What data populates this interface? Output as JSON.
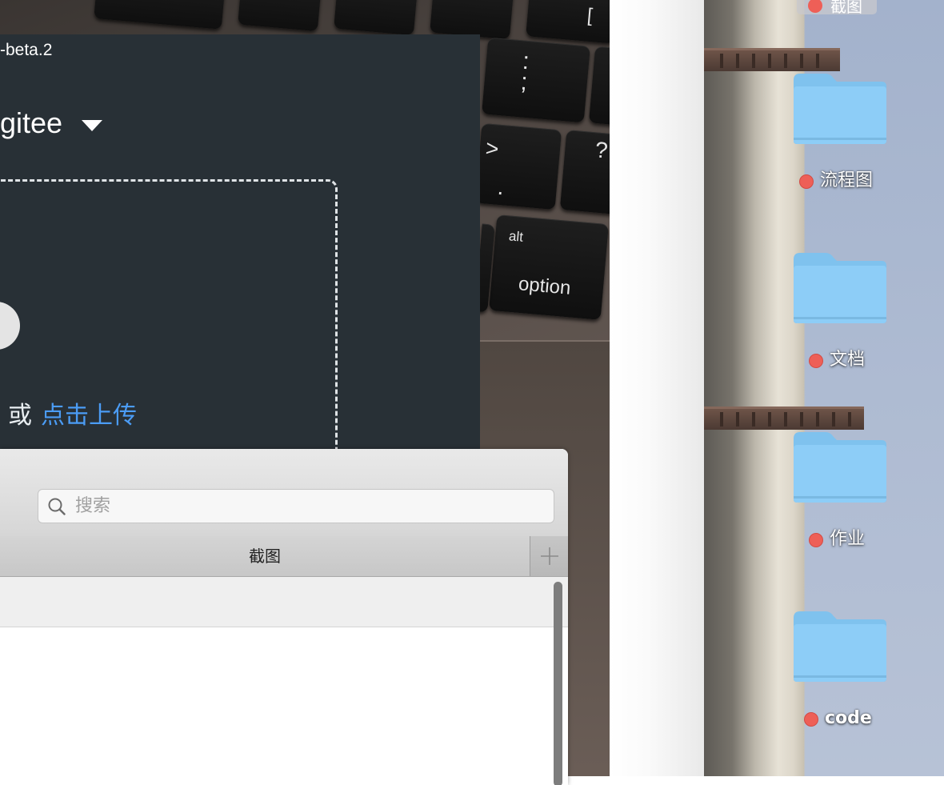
{
  "keyboard": {
    "alt_label": "alt",
    "option_label": "option",
    "gt_label": ">",
    "question_label": "?",
    "bracket_label": "["
  },
  "dark_window": {
    "version_text": "-beta.2",
    "repo_name": "gitee",
    "or_text": "或",
    "upload_link": "点击上传"
  },
  "list_window": {
    "search_placeholder": "搜索",
    "tab_label": "截图",
    "add_tab_icon": "plus-icon"
  },
  "desktop": {
    "top_partial_label": "截图",
    "folders": [
      {
        "label": "流程图",
        "tag_color": "#ee5f57"
      },
      {
        "label": "文档",
        "tag_color": "#ee5f57"
      },
      {
        "label": "作业",
        "tag_color": "#ee5f57"
      },
      {
        "label": "code",
        "tag_color": "#ee5f57"
      }
    ],
    "folder_color": "#8dcdf7"
  }
}
